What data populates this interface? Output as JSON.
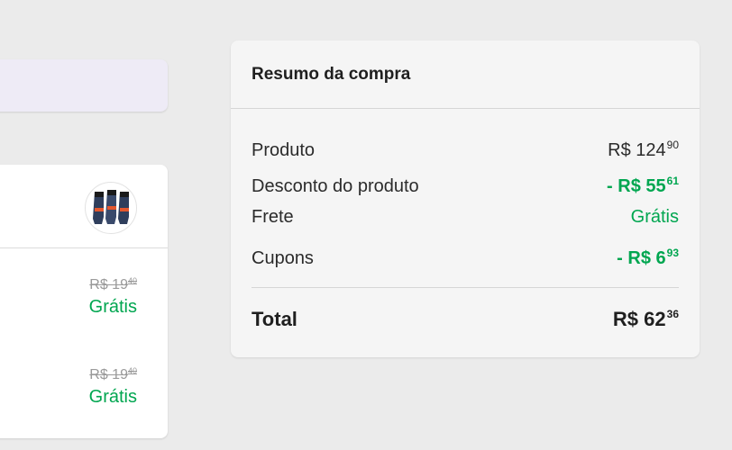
{
  "left_panel": {
    "shipping_rows": [
      {
        "old_price_int": "R$ 19",
        "old_price_cents": "40",
        "status": "Grátis"
      },
      {
        "old_price_int": "R$ 19",
        "old_price_cents": "40",
        "status": "Grátis"
      }
    ]
  },
  "summary": {
    "title": "Resumo da compra",
    "rows": [
      {
        "label": "Produto",
        "value_int": "R$ 124",
        "value_cents": "90"
      },
      {
        "label": "Desconto do produto",
        "value_int": "- R$ 55",
        "value_cents": "61"
      },
      {
        "label": "Frete",
        "value": "Grátis"
      },
      {
        "label": "Cupons",
        "value_int": "- R$ 6",
        "value_cents": "93"
      }
    ],
    "total": {
      "label": "Total",
      "value_int": "R$ 62",
      "value_cents": "36"
    }
  },
  "colors": {
    "accent_green": "#00a650",
    "background": "#ebebeb",
    "card": "#f5f5f5",
    "banner": "#eeebf6"
  }
}
